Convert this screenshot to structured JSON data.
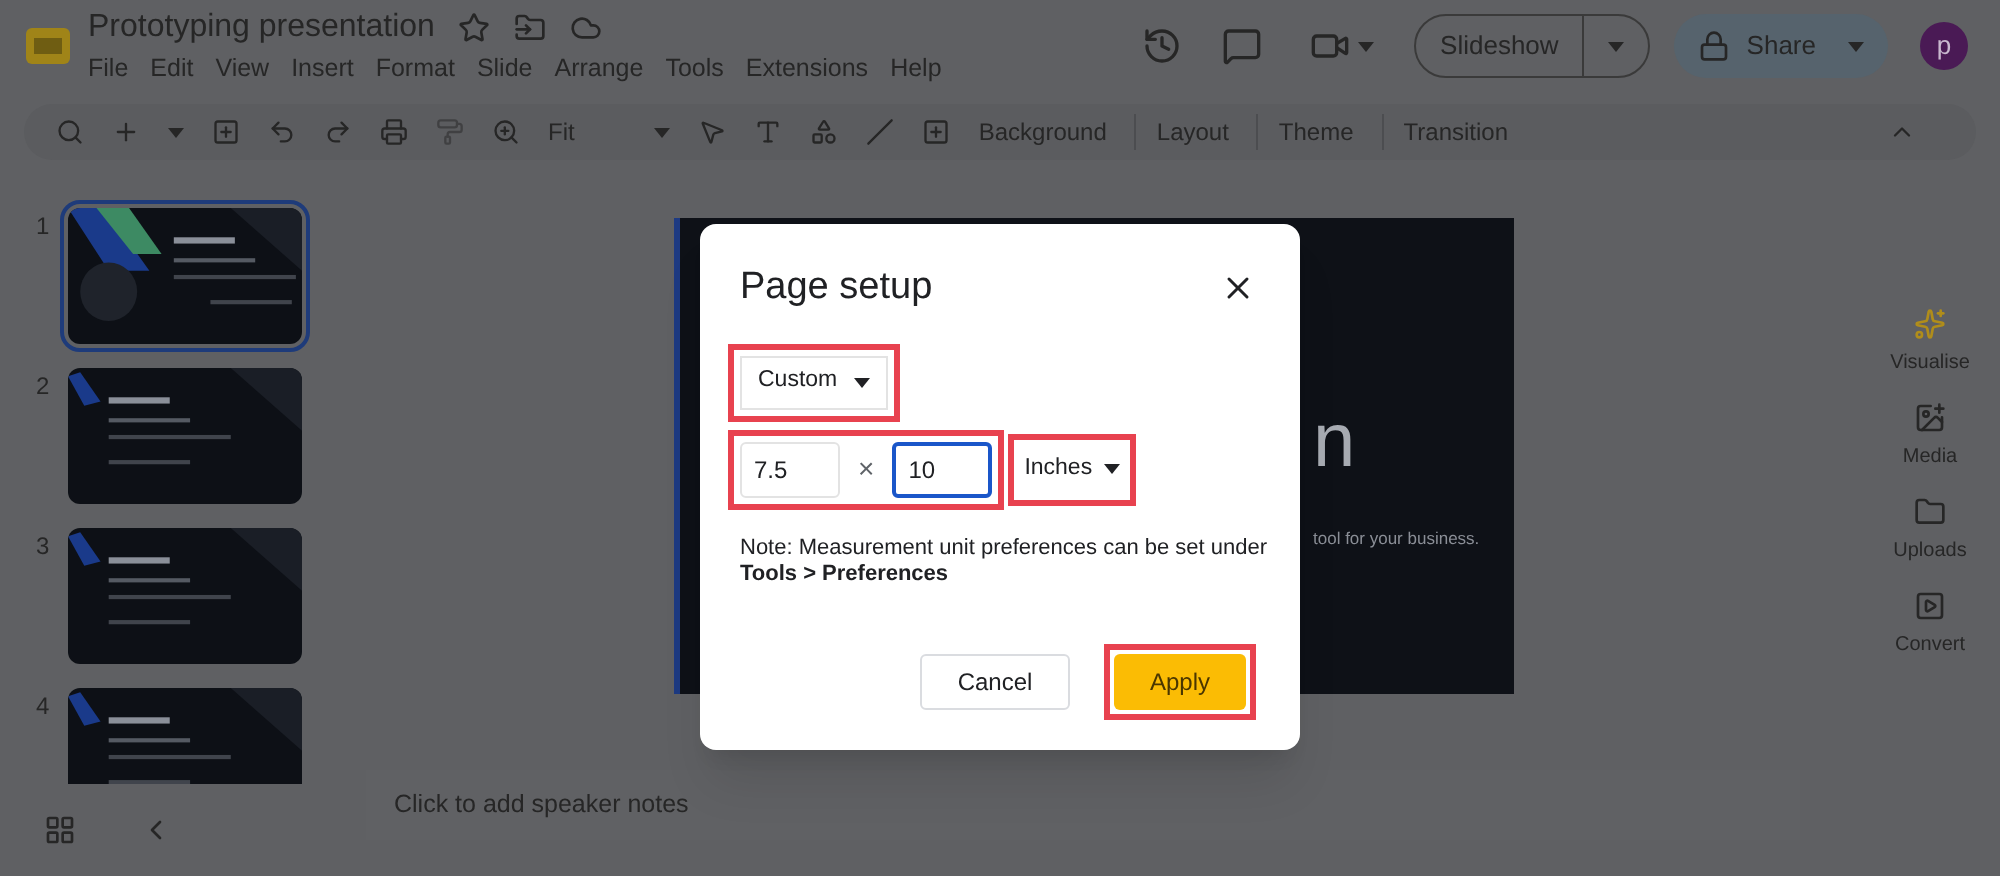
{
  "app": {
    "title": "Prototyping presentation",
    "menu": [
      "File",
      "Edit",
      "View",
      "Insert",
      "Format",
      "Slide",
      "Arrange",
      "Tools",
      "Extensions",
      "Help"
    ],
    "toolbar": {
      "zoom": "Fit",
      "buttons": [
        "Background",
        "Layout",
        "Theme",
        "Transition"
      ]
    },
    "slideshow": "Slideshow",
    "share": "Share",
    "avatar": "p"
  },
  "slides": [
    {
      "number": "1",
      "selected": true
    },
    {
      "number": "2",
      "selected": false
    },
    {
      "number": "3",
      "selected": false
    },
    {
      "number": "4",
      "selected": false
    }
  ],
  "slide_text": {
    "title_fragment": "n",
    "subtitle_fragment": "tool for your business."
  },
  "side_panel": [
    {
      "label": "Visualise",
      "kind": "sparkle"
    },
    {
      "label": "Media",
      "kind": "media"
    },
    {
      "label": "Uploads",
      "kind": "folder"
    },
    {
      "label": "Convert",
      "kind": "convert"
    }
  ],
  "notes": {
    "placeholder": "Click to add speaker notes"
  },
  "dialog": {
    "title": "Page setup",
    "preset": {
      "value": "Custom",
      "highlighted": true
    },
    "size": {
      "highlighted": true,
      "separator": "×",
      "fields": [
        {
          "value": "7.5",
          "focused": false
        },
        {
          "value": "10",
          "focused": true
        }
      ]
    },
    "unit": {
      "value": "Inches",
      "highlighted": true
    },
    "note": "Note: Measurement unit preferences can be set under **Tools > Preferences**",
    "buttons": [
      {
        "label": "Cancel",
        "kind": "secondary",
        "highlighted": false
      },
      {
        "label": "Apply",
        "kind": "primary",
        "highlighted": true
      }
    ]
  }
}
